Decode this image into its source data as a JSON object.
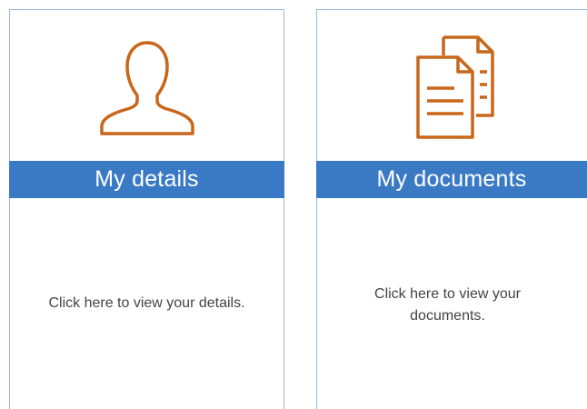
{
  "cards": [
    {
      "title": "My details",
      "description": "Click here to view your details.",
      "icon": "user-silhouette-icon"
    },
    {
      "title": "My documents",
      "description": "Click here to view your documents.",
      "icon": "documents-icon"
    }
  ],
  "colors": {
    "banner": "#3a7ac4",
    "icon": "#c8661a",
    "border": "#9bb7d4",
    "text": "#444444"
  }
}
